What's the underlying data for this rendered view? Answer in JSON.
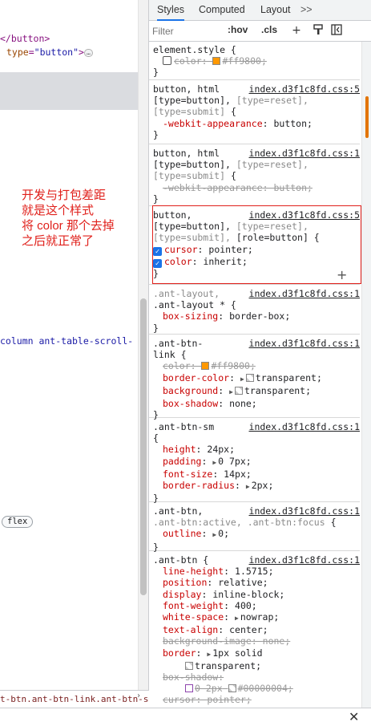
{
  "elements_panel": {
    "line1_tag": "</button>",
    "line2_attr": "type",
    "line2_val": "\"button\"",
    "line2_close": ">",
    "ellipsis": "…",
    "line3_class": "column ant-table-scroll-",
    "flex_badge": "flex",
    "breadcrumb": "t-btn.ant-btn-link.ant-btn-sm",
    "breadcrumb_arrow": "›"
  },
  "annotation": {
    "line1": "开发与打包差距",
    "line2": "就是这个样式",
    "line3": "将 color 那个去掉",
    "line4": "之后就正常了"
  },
  "tabs": {
    "styles": "Styles",
    "computed": "Computed",
    "layout": "Layout",
    "more": ">>"
  },
  "filter": {
    "placeholder": "Filter",
    "hov": ":hov",
    "cls": ".cls",
    "plus_icon": "+"
  },
  "rules": [
    {
      "selector": "element.style {",
      "props": [
        {
          "name": "color",
          "value": "#ff9800;",
          "swatch": "#ff9800",
          "checkbox": false,
          "strike": true
        }
      ],
      "close": "}"
    },
    {
      "selector": "button, html",
      "source": "index.d3f1c8fd.css:5",
      "sel2": "[type=button],",
      "sel2dim": " [type=reset],",
      "sel3dim": "[type=submit]",
      "sel3": " {",
      "props": [
        {
          "name": "-webkit-appearance",
          "value": "button;"
        }
      ],
      "close": "}"
    },
    {
      "selector": "button, html",
      "source": "index.d3f1c8fd.css:1",
      "sel2": "[type=button],",
      "sel2dim": " [type=reset],",
      "sel3dim": "[type=submit]",
      "sel3": " {",
      "props": [
        {
          "name": "-webkit-appearance",
          "value": "button;",
          "strike": true
        }
      ],
      "close": "}"
    },
    {
      "selector": "button,",
      "source": "index.d3f1c8fd.css:5",
      "sel2": "[type=button],",
      "sel2dim": " [type=reset],",
      "sel3dim": "[type=submit],",
      "sel3": " [role=button] {",
      "props": [
        {
          "name": "cursor",
          "value": "pointer;",
          "checkbox": true
        },
        {
          "name": "color",
          "value": "inherit;",
          "checkbox": true
        }
      ],
      "close": "}"
    },
    {
      "selector": ".ant-layout,",
      "source": "index.d3f1c8fd.css:1",
      "sel2": ".ant-layout * {",
      "props": [
        {
          "name": "box-sizing",
          "value": "border-box;"
        }
      ],
      "close": "}"
    },
    {
      "selector": ".ant-btn-",
      "source": "index.d3f1c8fd.css:1",
      "sel2": "link {",
      "props": [
        {
          "name": "color",
          "value": "#ff9800;",
          "swatch": "#ff9800",
          "strike": true
        },
        {
          "name": "border-color",
          "value": "transparent;",
          "tri": true,
          "swatch": "transparent"
        },
        {
          "name": "background",
          "value": "transparent;",
          "tri": true,
          "swatch": "transparent"
        },
        {
          "name": "box-shadow",
          "value": "none;"
        }
      ],
      "close": "}"
    },
    {
      "selector": ".ant-btn-sm",
      "source": "index.d3f1c8fd.css:1",
      "sel2": "{",
      "props": [
        {
          "name": "height",
          "value": "24px;"
        },
        {
          "name": "padding",
          "value": "0 7px;",
          "tri": true
        },
        {
          "name": "font-size",
          "value": "14px;"
        },
        {
          "name": "border-radius",
          "value": "2px;",
          "tri": true
        }
      ],
      "close": "}"
    },
    {
      "selector": ".ant-btn,",
      "source": "index.d3f1c8fd.css:1",
      "sel2dim": ".ant-btn:active, .ant-btn:focus",
      "sel3": " {",
      "props": [
        {
          "name": "outline",
          "value": "0;",
          "tri": true
        }
      ],
      "close": "}"
    },
    {
      "selector": ".ant-btn {",
      "source": "index.d3f1c8fd.css:1",
      "props": [
        {
          "name": "line-height",
          "value": "1.5715;"
        },
        {
          "name": "position",
          "value": "relative;"
        },
        {
          "name": "display",
          "value": "inline-block;"
        },
        {
          "name": "font-weight",
          "value": "400;"
        },
        {
          "name": "white-space",
          "value": "nowrap;",
          "tri": true
        },
        {
          "name": "text-align",
          "value": "center;"
        },
        {
          "name": "background-image",
          "value": "none;",
          "strike": true
        },
        {
          "name": "border",
          "value": "1px solid",
          "tri": true
        },
        {
          "name": "",
          "value": "transparent;",
          "swatch": "transparent",
          "indent": true
        },
        {
          "name": "box-shadow",
          "value": "",
          "strike": true
        },
        {
          "name": "",
          "value": "0 2px",
          "strike": true,
          "shadow_icon": true,
          "swatch": "transparent",
          "suffix": "#00000004;",
          "indent": true
        },
        {
          "name": "cursor",
          "value": "pointer;",
          "strike": true
        }
      ]
    }
  ],
  "close_icon": "✕"
}
